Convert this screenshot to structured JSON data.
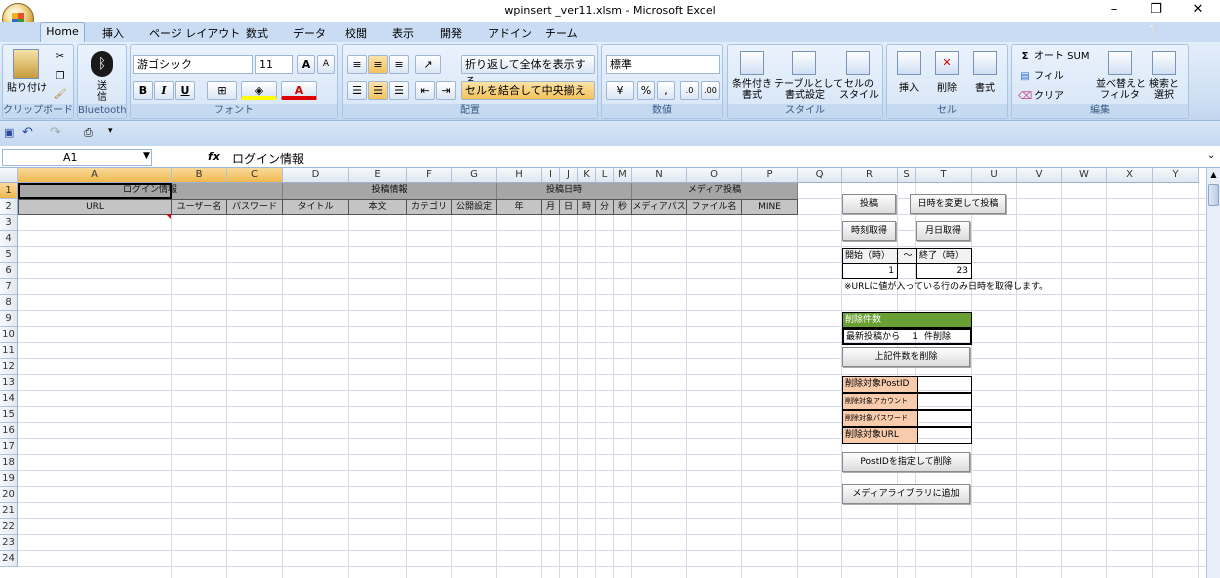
{
  "window": {
    "title": "wpinsert _ver11.xlsm - Microsoft Excel",
    "min": "–",
    "restore": "❐",
    "close": "✕"
  },
  "tabs": [
    "Home",
    "挿入",
    "ページ レイアウト",
    "数式",
    "データ",
    "校閲",
    "表示",
    "開発",
    "アドイン",
    "チーム"
  ],
  "ribbon": {
    "clipboard": {
      "paste": "貼り付け",
      "label": "クリップボード"
    },
    "bluetooth": {
      "send": "送信",
      "label": "Bluetooth"
    },
    "font": {
      "name": "游ゴシック",
      "size": "11",
      "label": "フォント",
      "bold": "B",
      "italic": "I",
      "underline": "U",
      "grow": "A",
      "shrink": "A"
    },
    "alignment": {
      "wrap": "折り返して全体を表示する",
      "merge": "セルを結合して中央揃え",
      "label": "配置"
    },
    "number": {
      "format": "標準",
      "percent": "%",
      "comma": ",",
      "label": "数値"
    },
    "styles": {
      "cond": "条件付き\n書式",
      "table": "テーブルとして\n書式設定",
      "cell": "セルの\nスタイル",
      "label": "スタイル"
    },
    "cells": {
      "insert": "挿入",
      "delete": "削除",
      "format": "書式",
      "label": "セル"
    },
    "editing": {
      "autosum": "オート SUM",
      "fill": "フィル",
      "clear": "クリア",
      "sort": "並べ替えと\nフィルタ",
      "find": "検索と\n選択",
      "label": "編集"
    }
  },
  "formula": {
    "namebox": "A1",
    "fx": "fx",
    "value": "ログイン情報"
  },
  "columns": [
    "A",
    "B",
    "C",
    "D",
    "E",
    "F",
    "G",
    "H",
    "I",
    "J",
    "K",
    "L",
    "M",
    "N",
    "O",
    "P",
    "Q",
    "R",
    "S",
    "T",
    "U",
    "V",
    "W",
    "X",
    "Y"
  ],
  "rows": [
    "1",
    "2",
    "3",
    "4",
    "5",
    "6",
    "7",
    "8",
    "9",
    "10",
    "11",
    "12",
    "13",
    "14",
    "15",
    "16",
    "17",
    "18",
    "19",
    "20",
    "21",
    "22",
    "23",
    "24"
  ],
  "sheet": {
    "group_login": "ログイン情報",
    "group_post": "投稿情報",
    "group_date": "投稿日時",
    "group_media": "メディア投稿",
    "h_url": "URL",
    "h_user": "ユーザー名",
    "h_pass": "パスワード",
    "h_title": "タイトル",
    "h_body": "本文",
    "h_cat": "カテゴリ",
    "h_pub": "公開設定",
    "h_year": "年",
    "h_month": "月",
    "h_day": "日",
    "h_hour": "時",
    "h_min": "分",
    "h_sec": "秒",
    "h_mpath": "メディアパス",
    "h_fname": "ファイル名",
    "h_mime": "MINE"
  },
  "panel": {
    "btn_post": "投稿",
    "btn_change_post": "日時を変更して投稿",
    "btn_time": "時刻取得",
    "btn_monthday": "月日取得",
    "start_label": "開始（時）",
    "tilde": "～",
    "end_label": "終了（時）",
    "start_val": "1",
    "end_val": "23",
    "note": "※URLに値が入っている行のみ日時を取得します。",
    "del_count_header": "削除件数",
    "del_from": "最新投稿から",
    "del_num": "1",
    "del_suffix": "件削除",
    "btn_del_count": "上記件数を削除",
    "del_postid": "削除対象PostID",
    "del_account": "削除対象アカウント",
    "del_password": "削除対象パスワード",
    "del_url": "削除対象URL",
    "btn_del_postid": "PostIDを指定して削除",
    "btn_media": "メディアライブラリに追加"
  }
}
